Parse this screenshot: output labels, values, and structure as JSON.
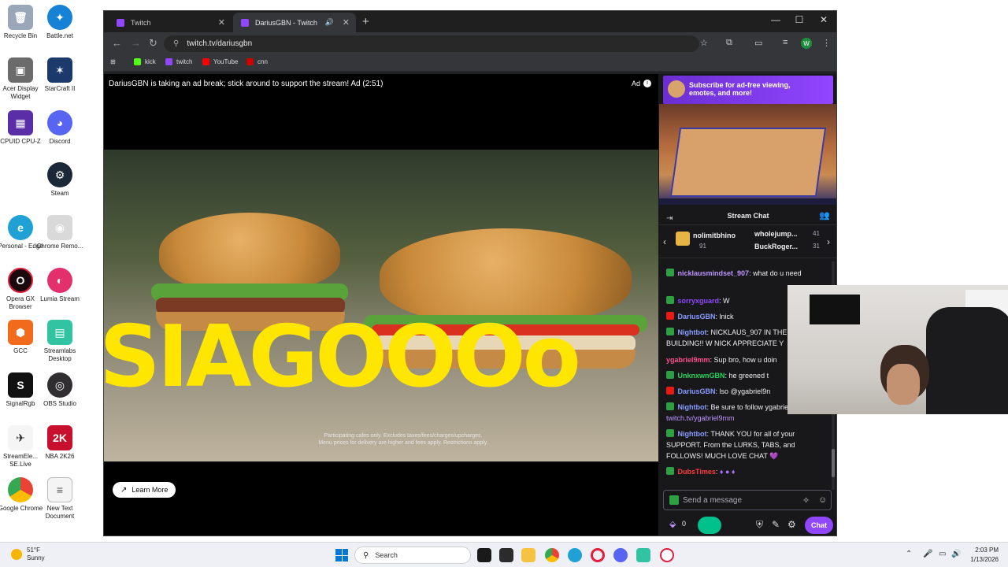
{
  "desktop": {
    "icons": [
      {
        "label": "Recycle Bin"
      },
      {
        "label": "Battle.net"
      },
      {
        "label": "Acer Display Widget"
      },
      {
        "label": "StarCraft II"
      },
      {
        "label": "CPUID CPU-Z"
      },
      {
        "label": "Discord"
      },
      {
        "label": "Steam"
      },
      {
        "label": "Personal - Edge"
      },
      {
        "label": "Chrome Remo..."
      },
      {
        "label": "Opera GX Browser"
      },
      {
        "label": "Lumia Stream"
      },
      {
        "label": "GCC"
      },
      {
        "label": "Streamlabs Desktop"
      },
      {
        "label": "SignalRgb"
      },
      {
        "label": "OBS Studio"
      },
      {
        "label": "StreamEle... SE.Live"
      },
      {
        "label": "NBA 2K26"
      },
      {
        "label": "Google Chrome"
      },
      {
        "label": "New Text Document"
      }
    ]
  },
  "browser": {
    "tabs": [
      {
        "title": "Twitch"
      },
      {
        "title": "DariusGBN - Twitch"
      }
    ],
    "url": "twitch.tv/dariusgbn",
    "bookmarks": [
      {
        "label": "kick",
        "color": "#53fc18"
      },
      {
        "label": "twitch",
        "color": "#9146ff"
      },
      {
        "label": "YouTube",
        "color": "#ff0000"
      },
      {
        "label": "cnn",
        "color": "#cc0000"
      }
    ]
  },
  "player": {
    "ad_message": "DariusGBN is taking an ad break; stick around to support the stream! Ad (2:51)",
    "ad_label": "Ad",
    "headline": "SIAGOOOo",
    "disclaimer_line1": "Participating cafes only. Excludes taxes/fees/charges/upcharges.",
    "disclaimer_line2": "Menu prices for delivery are higher and fees apply. Restrictions apply.",
    "learn_more": "Learn More"
  },
  "side": {
    "sub_banner_line1": "Subscribe for ad-free viewing,",
    "sub_banner_line2": "emotes, and more!",
    "chat_title": "Stream Chat",
    "leaderboard": {
      "first_name": "nolimitbhino",
      "first_score": "91",
      "second_name": "wholejump...",
      "second_score": "41",
      "third_name": "BuckRoger...",
      "third_score": "31"
    },
    "messages": [
      {
        "user": "nicklausmindset_907",
        "user_color": "#bf94ff",
        "text": ": what do u need"
      },
      {
        "user": "sorryxguard",
        "user_color": "#9147ff",
        "text": ": W"
      },
      {
        "user": "DariusGBN",
        "user_color": "#8a9cff",
        "text": ": lnick"
      },
      {
        "user": "Nightbot",
        "user_color": "#8a9cff",
        "text": ": NICKLAUS_907 IN THE BUILDING!! W NICK APPRECIATE Y"
      },
      {
        "user": "ygabriel9mm",
        "user_color": "#ff4f8b",
        "text": ": Sup bro, how u doin"
      },
      {
        "user": "UnknxwnGBN",
        "user_color": "#1ed760",
        "text": ": he greened t"
      },
      {
        "user": "DariusGBN",
        "user_color": "#8a9cff",
        "text": ": lso @ygabriel9n"
      },
      {
        "user": "Nightbot",
        "user_color": "#8a9cff",
        "text": ": Be sure to follow ygabriel9mm at ",
        "link": "twitch.tv/ygabriel9mm"
      },
      {
        "user": "Nightbot",
        "user_color": "#8a9cff",
        "text": ": THANK YOU for all of your SUPPORT. From the LURKS, TABS, and FOLLOWS! MUCH LOVE CHAT",
        "emoji": "💜"
      },
      {
        "user": "DubsTimes",
        "user_color": "#ff3b3b",
        "text": ":"
      }
    ],
    "input_placeholder": "Send a message",
    "points": "0",
    "chat_button": "Chat"
  },
  "taskbar": {
    "temperature": "51°F",
    "condition": "Sunny",
    "search_label": "Search",
    "time": "2:03 PM",
    "date": "1/13/2026"
  }
}
